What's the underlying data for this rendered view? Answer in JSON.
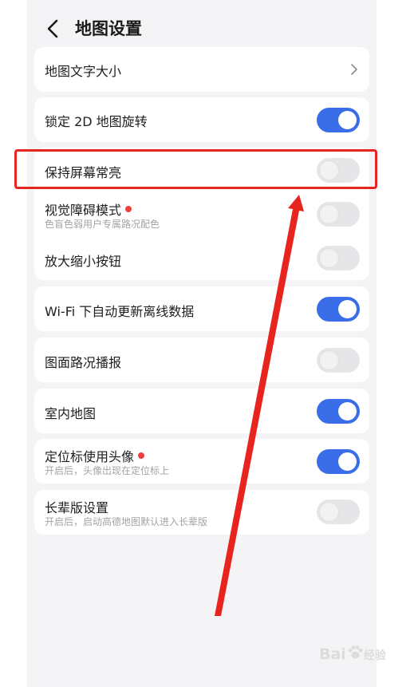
{
  "header": {
    "title": "地图设置"
  },
  "settings": [
    {
      "label": "地图文字大小",
      "type": "link"
    },
    {
      "label": "锁定 2D 地图旋转",
      "state": "on"
    },
    {
      "label": "保持屏幕常亮",
      "state": "off"
    },
    {
      "label": "视觉障碍模式",
      "subtitle": "色盲色弱用户专属路况配色",
      "state": "off",
      "badge": "red-dot"
    },
    {
      "label": "放大缩小按钮",
      "state": "off"
    },
    {
      "label": "Wi-Fi 下自动更新离线数据",
      "state": "on"
    },
    {
      "label": "图面路况播报",
      "state": "off"
    },
    {
      "label": "室内地图",
      "state": "on"
    },
    {
      "label": "定位标使用头像",
      "subtitle": "开启后，头像出现在定位标上",
      "state": "on",
      "badge": "red-dot"
    },
    {
      "label": "长辈版设置",
      "subtitle": "开启后，启动高德地图默认进入长辈版",
      "state": "off"
    }
  ],
  "watermark": {
    "text": "Bai",
    "suffix": "经验"
  },
  "colors": {
    "toggle_on": "#3a6ee8",
    "toggle_off": "#e6e6e9",
    "annotation": "#e8241f",
    "badge_dot": "#f03d3d"
  },
  "icons": [
    "back-chevron-icon",
    "chevron-right-icon",
    "paw-icon"
  ]
}
